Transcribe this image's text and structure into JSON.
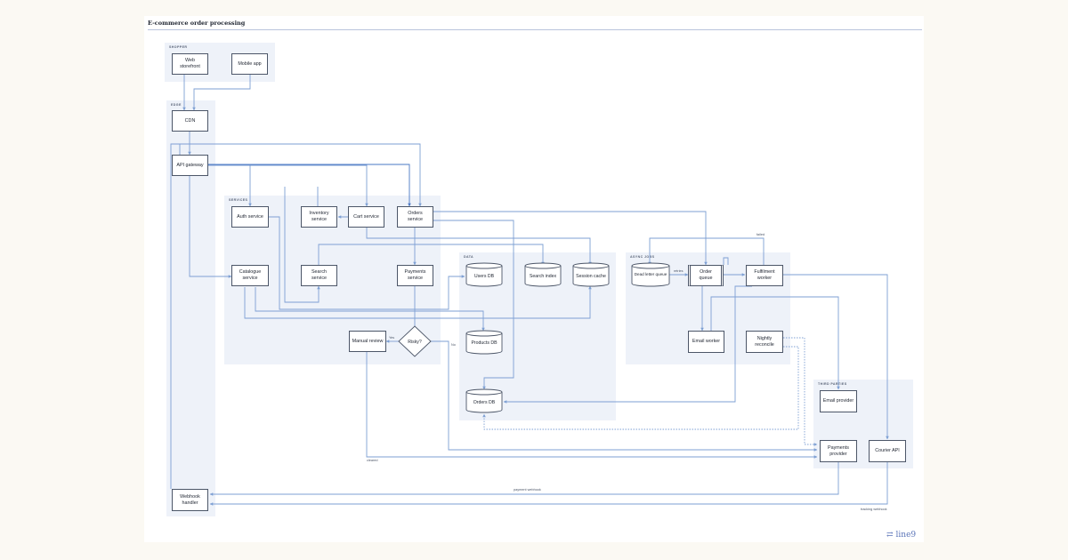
{
  "diagram": {
    "title": "E-commerce order processing",
    "groups": [
      {
        "id": "shopper",
        "label": "SHOPPER"
      },
      {
        "id": "edge",
        "label": "EDGE"
      },
      {
        "id": "services",
        "label": "SERVICES"
      },
      {
        "id": "data",
        "label": "DATA"
      },
      {
        "id": "async",
        "label": "ASYNC JOBS"
      },
      {
        "id": "third",
        "label": "THIRD PARTIES"
      }
    ],
    "nodes": {
      "web_storefront": "Web storefront",
      "mobile_app": "Mobile app",
      "cdn": "CDN",
      "api_gateway": "API gateway",
      "webhook_handler": "Webhook handler",
      "auth_service": "Auth service",
      "inventory_service": "Inventory service",
      "cart_service": "Cart service",
      "orders_service": "Orders service",
      "catalogue_service": "Catalogue service",
      "search_service": "Search service",
      "payments_service": "Payments service",
      "manual_review": "Manual review",
      "risky": "Risky?",
      "users_db": "Users DB",
      "search_index": "Search index",
      "session_cache": "Session cache",
      "products_db": "Products DB",
      "orders_db": "Orders DB",
      "dead_letter_queue": "Dead letter queue",
      "order_queue": "Order queue",
      "fulfilment_worker": "Fulfilment worker",
      "email_worker": "Email worker",
      "nightly_reconcile": "Nightly reconcile",
      "email_provider": "Email provider",
      "payments_provider": "Payments provider",
      "courier_api": "Courier API"
    },
    "edge_labels": {
      "failed": "failed",
      "retries": "retries",
      "yes": "Yes",
      "no": "No",
      "cleared": "cleared",
      "payment_webhook": "payment webhook",
      "tracking_webhook": "tracking webhook"
    },
    "colors": {
      "edge": "#7d9fd3",
      "edge_strong": "#4a78c4",
      "group_fill": "#eef2f9",
      "node_border": "#4c5668"
    }
  },
  "brand": {
    "name": "line9",
    "icon": "link-arrows-icon"
  }
}
